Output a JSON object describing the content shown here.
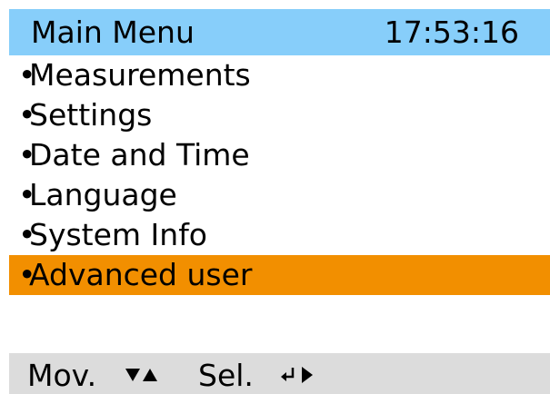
{
  "header": {
    "title": "Main Menu",
    "clock": "17:53:16"
  },
  "menu": {
    "items": [
      {
        "label": "Measurements"
      },
      {
        "label": "Settings"
      },
      {
        "label": "Date and Time"
      },
      {
        "label": "Language"
      },
      {
        "label": "System Info"
      },
      {
        "label": "Advanced user",
        "selected": true
      }
    ]
  },
  "footer": {
    "move_label": "Mov.",
    "move_icon": "down-up-arrows-icon",
    "select_label": "Sel.",
    "select_icon": "enter-right-arrow-icon"
  },
  "colors": {
    "header_bg": "#87cefa",
    "selected_bg": "#f28f00",
    "footer_bg": "#dcdcdc"
  }
}
